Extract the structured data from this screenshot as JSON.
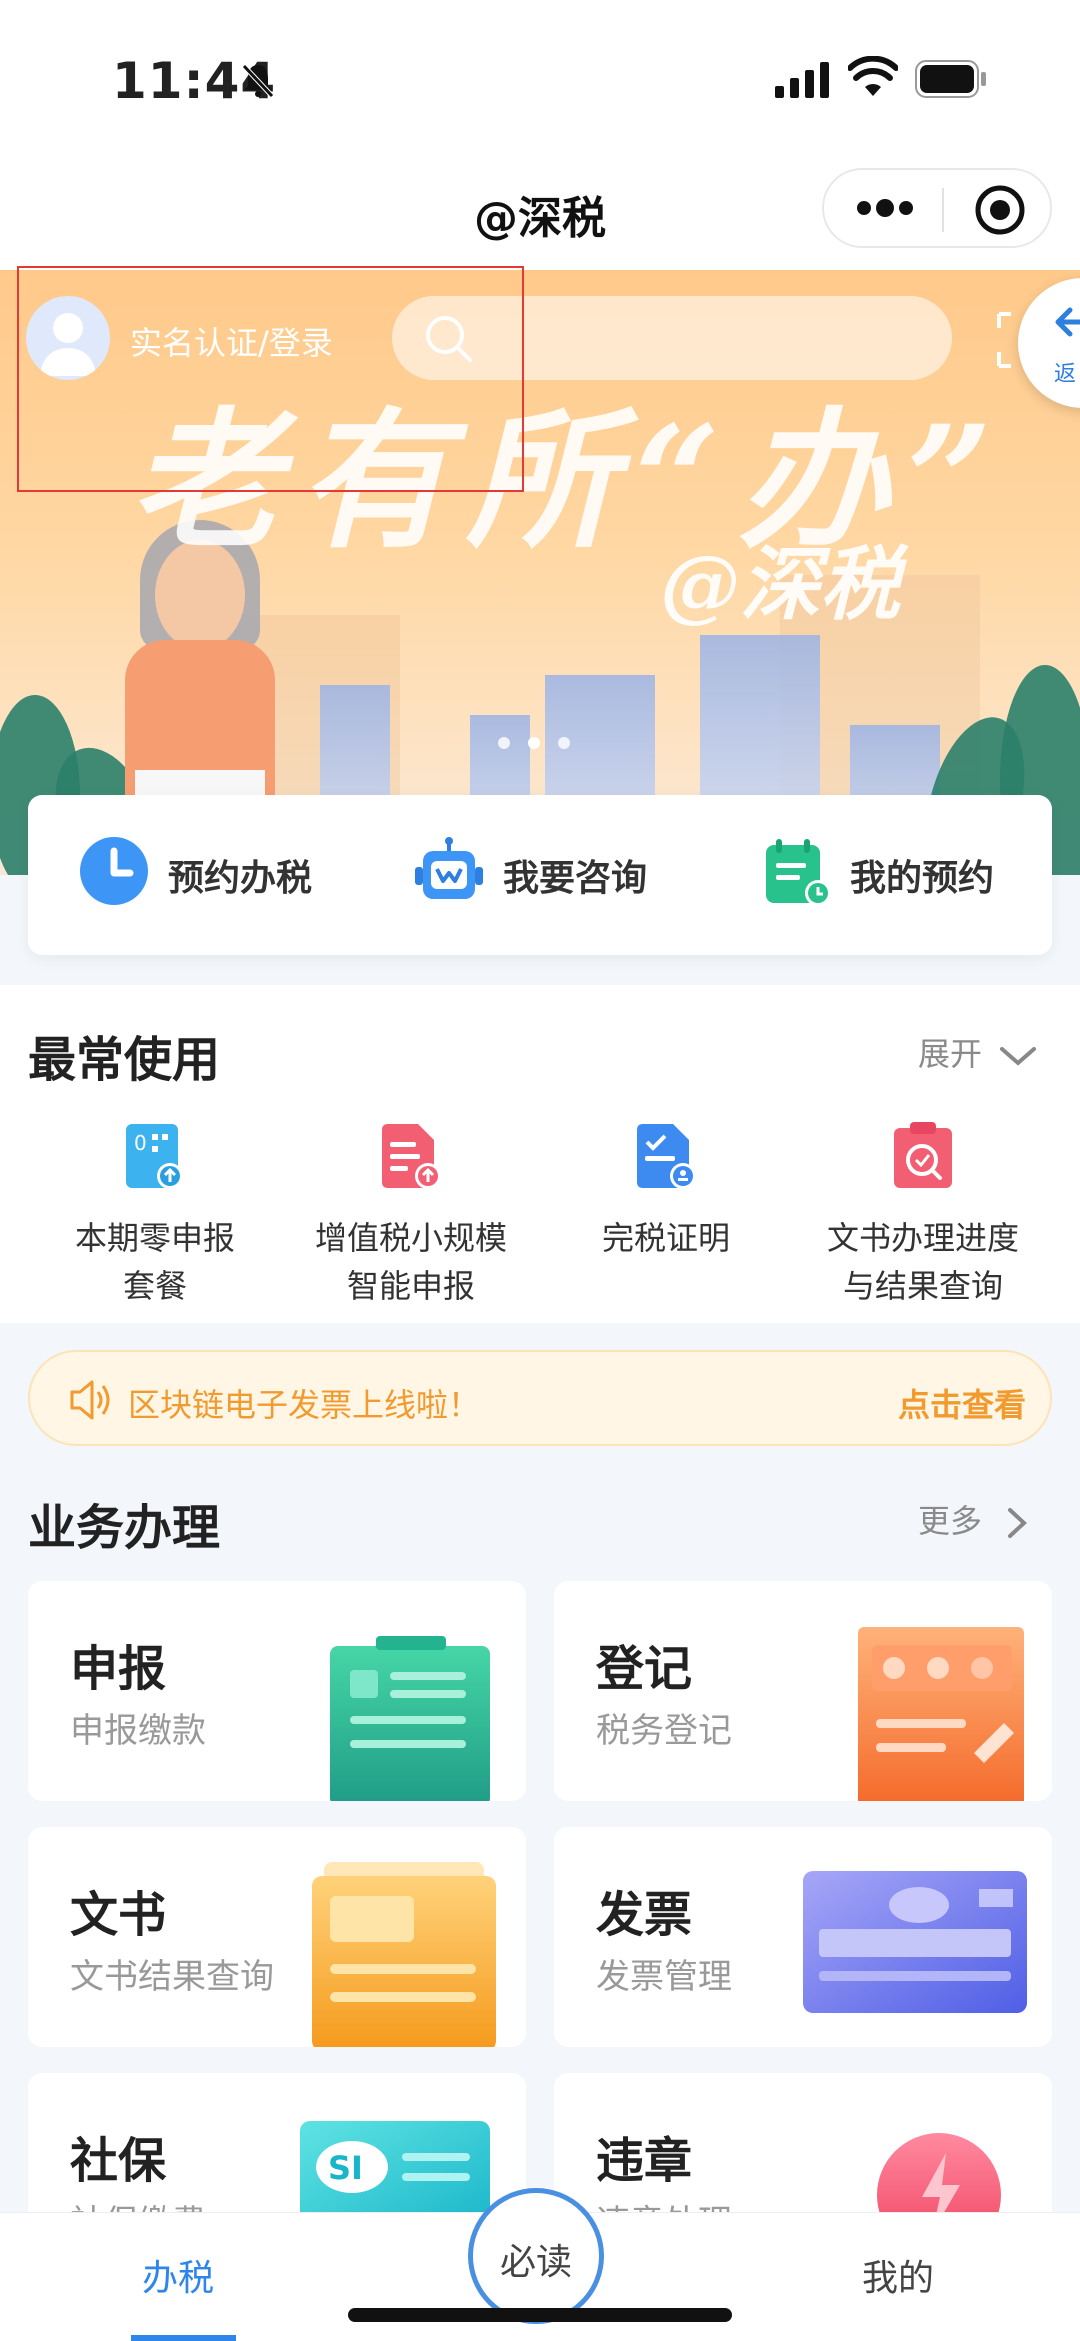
{
  "status": {
    "time": "11:44"
  },
  "nav": {
    "title": "@深税"
  },
  "banner": {
    "user_label": "实名认证/登录",
    "slogan": "老有所“办”",
    "slogan_brand": "@深税",
    "return_label": "返"
  },
  "quick_actions": [
    {
      "label": "预约办税",
      "icon": "clock-icon"
    },
    {
      "label": "我要咨询",
      "icon": "robot-icon"
    },
    {
      "label": "我的预约",
      "icon": "calendar-icon"
    }
  ],
  "frequent": {
    "title": "最常使用",
    "expand_label": "展开",
    "items": [
      {
        "label": "本期零申报\n套餐",
        "icon": "zero-report-icon"
      },
      {
        "label": "增值税小规模\n智能申报",
        "icon": "vat-report-icon"
      },
      {
        "label": "完税证明",
        "icon": "tax-certificate-icon"
      },
      {
        "label": "文书办理进度\n与结果查询",
        "icon": "document-query-icon"
      }
    ]
  },
  "notice": {
    "text": "区块链电子发票上线啦！",
    "link": "点击查看"
  },
  "business": {
    "title": "业务办理",
    "more_label": "更多",
    "cards": [
      {
        "title": "申报",
        "subtitle": "申报缴款"
      },
      {
        "title": "登记",
        "subtitle": "税务登记"
      },
      {
        "title": "文书",
        "subtitle": "文书结果查询"
      },
      {
        "title": "发票",
        "subtitle": "发票管理"
      },
      {
        "title": "社保",
        "subtitle": "社保缴费"
      },
      {
        "title": "违章",
        "subtitle": "违章处理"
      }
    ]
  },
  "tabbar": {
    "left": "办税",
    "center": "必读",
    "right": "我的"
  },
  "colors": {
    "accent": "#2f86ea",
    "notice": "#f29a2e"
  }
}
